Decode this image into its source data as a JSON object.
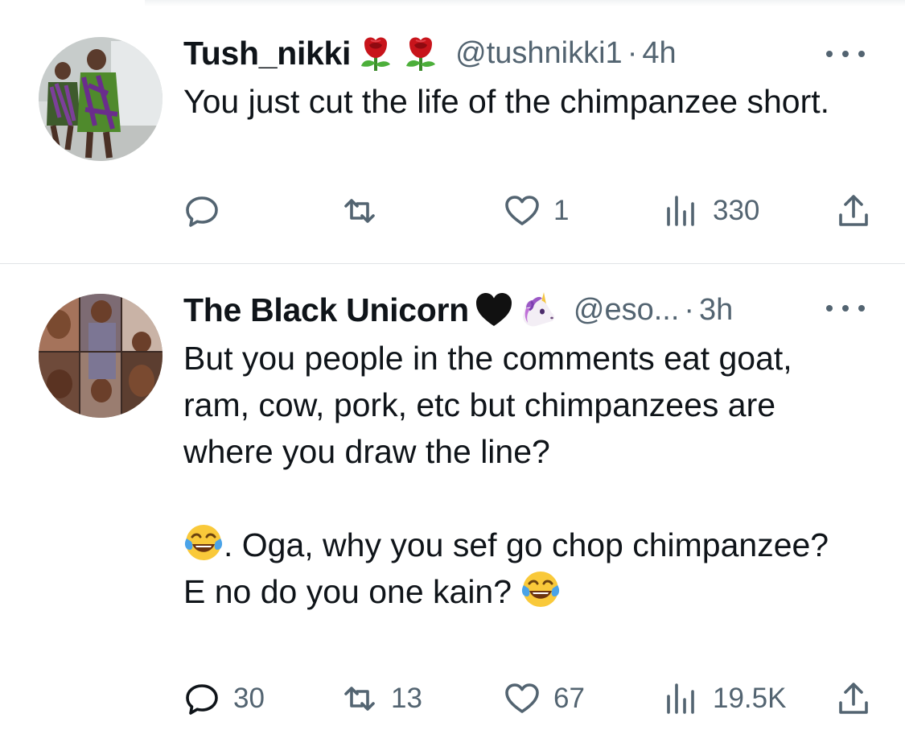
{
  "tweets": [
    {
      "display_name": "Tush_nikki",
      "name_emojis": [
        "rose-emoji",
        "rose-emoji"
      ],
      "handle": "@tushnikki1",
      "separator": "·",
      "time": "4h",
      "text": [
        "You just  cut the life of the chimpanzee short."
      ],
      "actions": {
        "reply": "",
        "retweet": "",
        "like": "1",
        "views": "330"
      }
    },
    {
      "display_name": "The Black Unicorn",
      "name_emojis": [
        "black-heart-emoji",
        "unicorn-emoji"
      ],
      "handle": "@eso...",
      "separator": "·",
      "time": "3h",
      "text": [
        "But you people in the comments eat goat, ram, cow, pork, etc but chimpanzees are where you draw the line?",
        ". Oga, why you sef go chop chimpanzee? E no do you one kain?"
      ],
      "text_emojis": [
        "tears-of-joy-emoji",
        "tears-of-joy-emoji"
      ],
      "actions": {
        "reply": "30",
        "retweet": "13",
        "like": "67",
        "views": "19.5K"
      }
    }
  ],
  "colors": {
    "text": "#0f1419",
    "secondary": "#536471",
    "divider": "#e1e4e6"
  }
}
